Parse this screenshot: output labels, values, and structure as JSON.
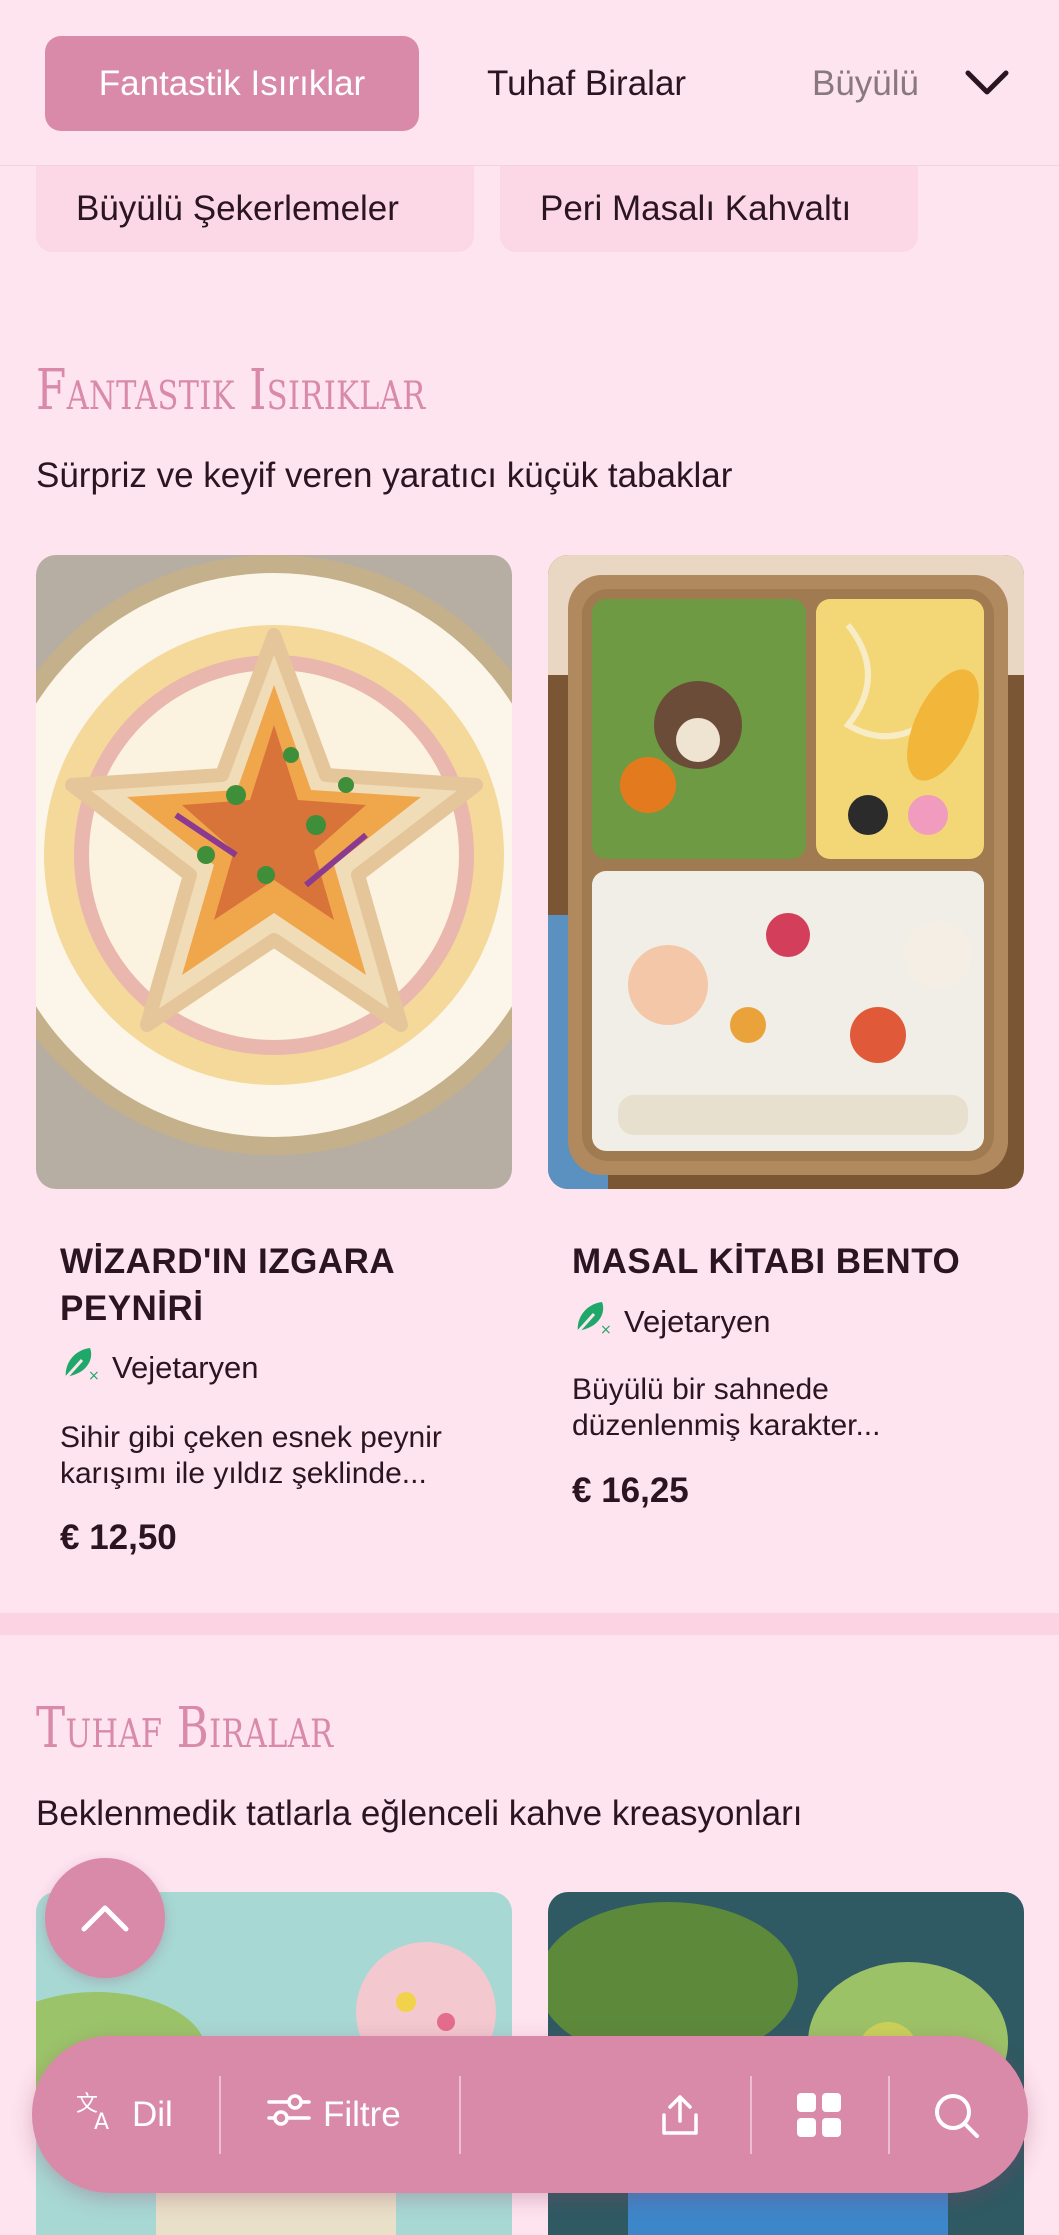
{
  "nav": {
    "tabs": [
      {
        "label": "Fantastik Isırıklar",
        "active": true
      },
      {
        "label": "Tuhaf Biralar"
      },
      {
        "label": "Büyülü"
      }
    ],
    "chips": [
      "Büyülü Şekerlemeler",
      "Peri Masalı Kahvaltı"
    ]
  },
  "sections": [
    {
      "title": "Fantastik Isırıklar",
      "subtitle": "Sürpriz ve keyif veren yaratıcı küçük tabaklar",
      "items": [
        {
          "title": "WİZARD'IN IZGARA PEYNİRİ",
          "diet": "Vejetaryen",
          "description": "Sihir gibi çeken esnek peynir karışımı ile yıldız şeklinde...",
          "price": "€ 12,50"
        },
        {
          "title": "MASAL KİTABI BENTO",
          "diet": "Vejetaryen",
          "description": "Büyülü bir sahnede düzenlenmiş karakter...",
          "price": "€ 16,25"
        }
      ]
    },
    {
      "title": "Tuhaf Biralar",
      "subtitle": "Beklenmedik tatlarla eğlenceli kahve kreasyonları"
    }
  ],
  "bottom_bar": {
    "language_label": "Dil",
    "filter_label": "Filtre"
  },
  "colors": {
    "background": "#fde4ee",
    "accent": "#d98aa8",
    "diet_icon": "#1fa86a"
  }
}
